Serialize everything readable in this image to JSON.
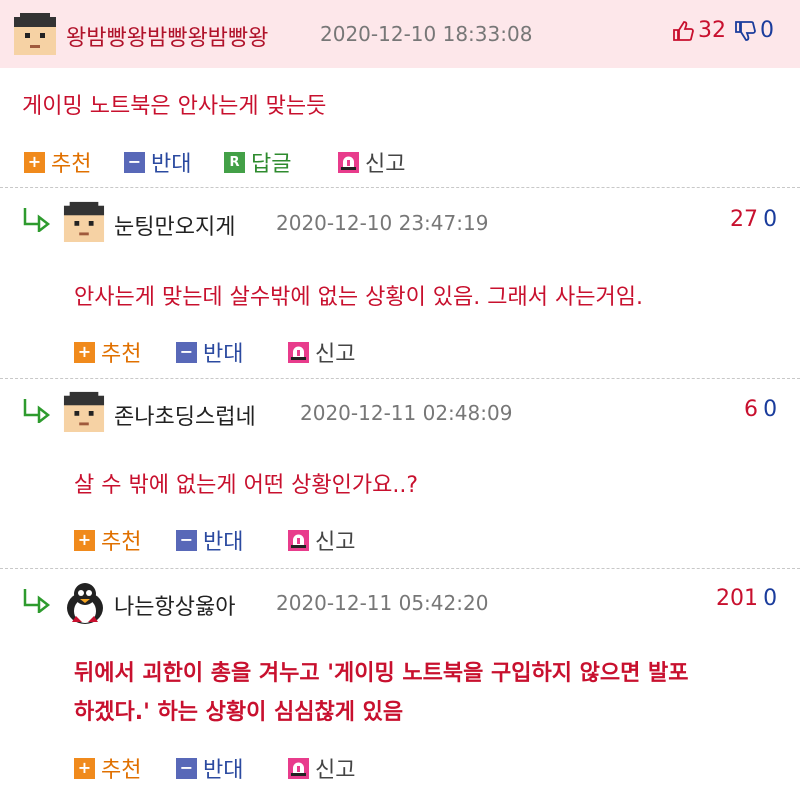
{
  "comments": [
    {
      "nickname": "왕밤빵왕밤빵왕밤빵왕",
      "date": "2020-12-10 18:33:08",
      "body": "게이밍 노트북은 안사는게 맞는듯",
      "up_count": "32",
      "down_count": "0",
      "actions": {
        "up": "추천",
        "down": "반대",
        "reply": "답글",
        "report": "신고"
      }
    },
    {
      "nickname": "눈팅만오지게",
      "date": "2020-12-10 23:47:19",
      "body": "안사는게 맞는데 살수밖에 없는 상황이 있음. 그래서 사는거임.",
      "up_count": "27",
      "down_count": "0",
      "actions": {
        "up": "추천",
        "down": "반대",
        "report": "신고"
      }
    },
    {
      "nickname": "존나초딩스럽네",
      "date": "2020-12-11 02:48:09",
      "body": "살 수 밖에 없는게 어떤 상황인가요..?",
      "up_count": "6",
      "down_count": "0",
      "actions": {
        "up": "추천",
        "down": "반대",
        "report": "신고"
      }
    },
    {
      "nickname": "나는항상옳아",
      "date": "2020-12-11 05:42:20",
      "body_lines": [
        "뒤에서 괴한이 총을 겨누고 '게이밍 노트북을 구입하지 않으면 발포",
        "하겠다.' 하는 상황이 심심찮게 있음"
      ],
      "up_count": "201",
      "down_count": "0",
      "actions": {
        "up": "추천",
        "down": "반대",
        "report": "신고"
      }
    }
  ],
  "icons": {
    "up": "plus-square-icon",
    "down": "minus-square-icon",
    "reply": "reply-r-icon",
    "report": "siren-icon",
    "thumb_up": "thumbs-up-icon",
    "thumb_down": "thumbs-down-icon",
    "reply_arrow": "reply-arrow-icon",
    "avatar": "user-avatar-icon"
  },
  "colors": {
    "header_bg": "#fde7ea",
    "body_text": "#c8102e",
    "up_count": "#c8102e",
    "down_count": "#1a3c9c"
  }
}
